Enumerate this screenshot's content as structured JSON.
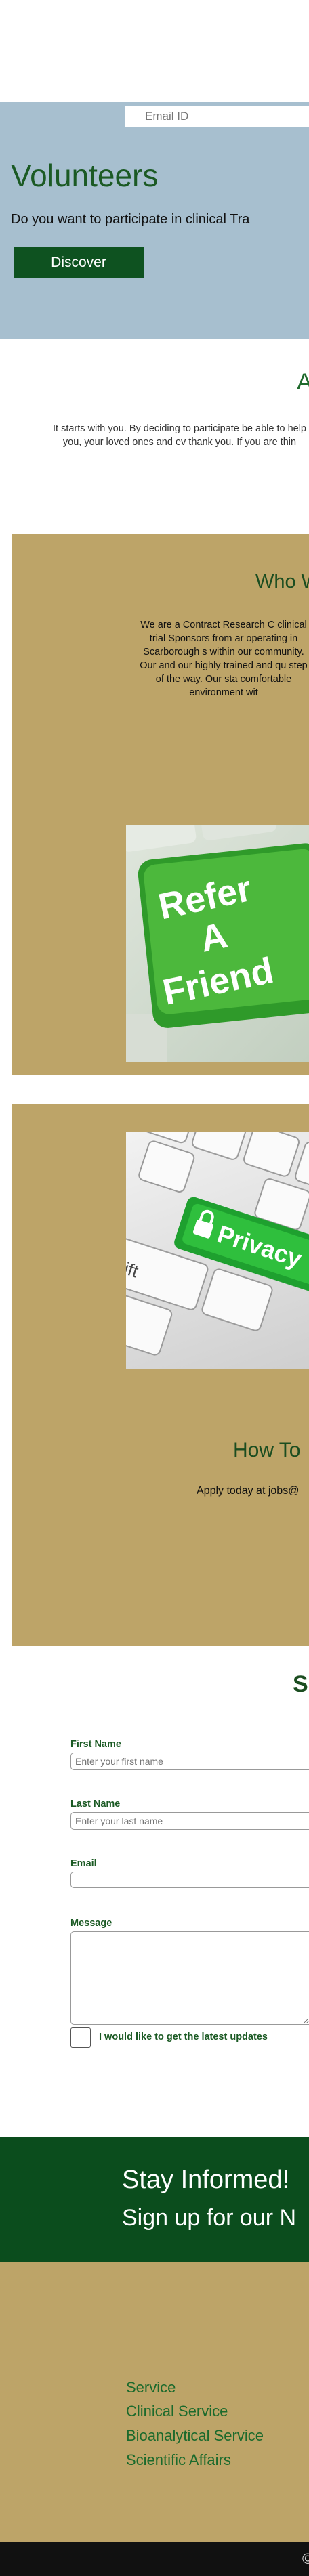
{
  "hero": {
    "title": "Volunteers",
    "subtitle": "Do you want to participate in clinical Tra",
    "button": "Discover",
    "background": "#a7bfcf"
  },
  "about": {
    "title": "A",
    "text": "It starts with you.  By deciding to participate be able to help you, your loved ones and ev thank you.  If you are thin"
  },
  "who": {
    "title": "Who W",
    "text": "We are a Contract Research C clinical trial Sponsors from ar operating in Scarborough s within our community.  Our and our highly trained and qu step of the way.  Our sta comfortable environment wit",
    "image_text": [
      "Refer",
      "A",
      "Friend"
    ]
  },
  "how": {
    "image_text": "Privacy",
    "image_key_text": "shift",
    "title": "How To",
    "text": "Apply today at jobs@"
  },
  "form": {
    "title": "S",
    "first_name_label": "First Name",
    "first_name_placeholder": "Enter your first name",
    "last_name_label": "Last Name",
    "last_name_placeholder": "Enter your last name",
    "email_label": "Email",
    "message_label": "Message",
    "updates_label": "I would like to get the latest updates"
  },
  "newsletter": {
    "title": "Stay Informed!",
    "subtitle": "Sign up for our N",
    "email_placeholder": "Email ID"
  },
  "footer": {
    "links": [
      "Service",
      "Clinical Service",
      "Bioanalytical Service",
      "Scientific Affairs"
    ],
    "copyright": "©"
  },
  "colors": {
    "brand_green": "#0e5220",
    "panel_gold": "#bda468",
    "hero_blue": "#a7bfcf"
  }
}
